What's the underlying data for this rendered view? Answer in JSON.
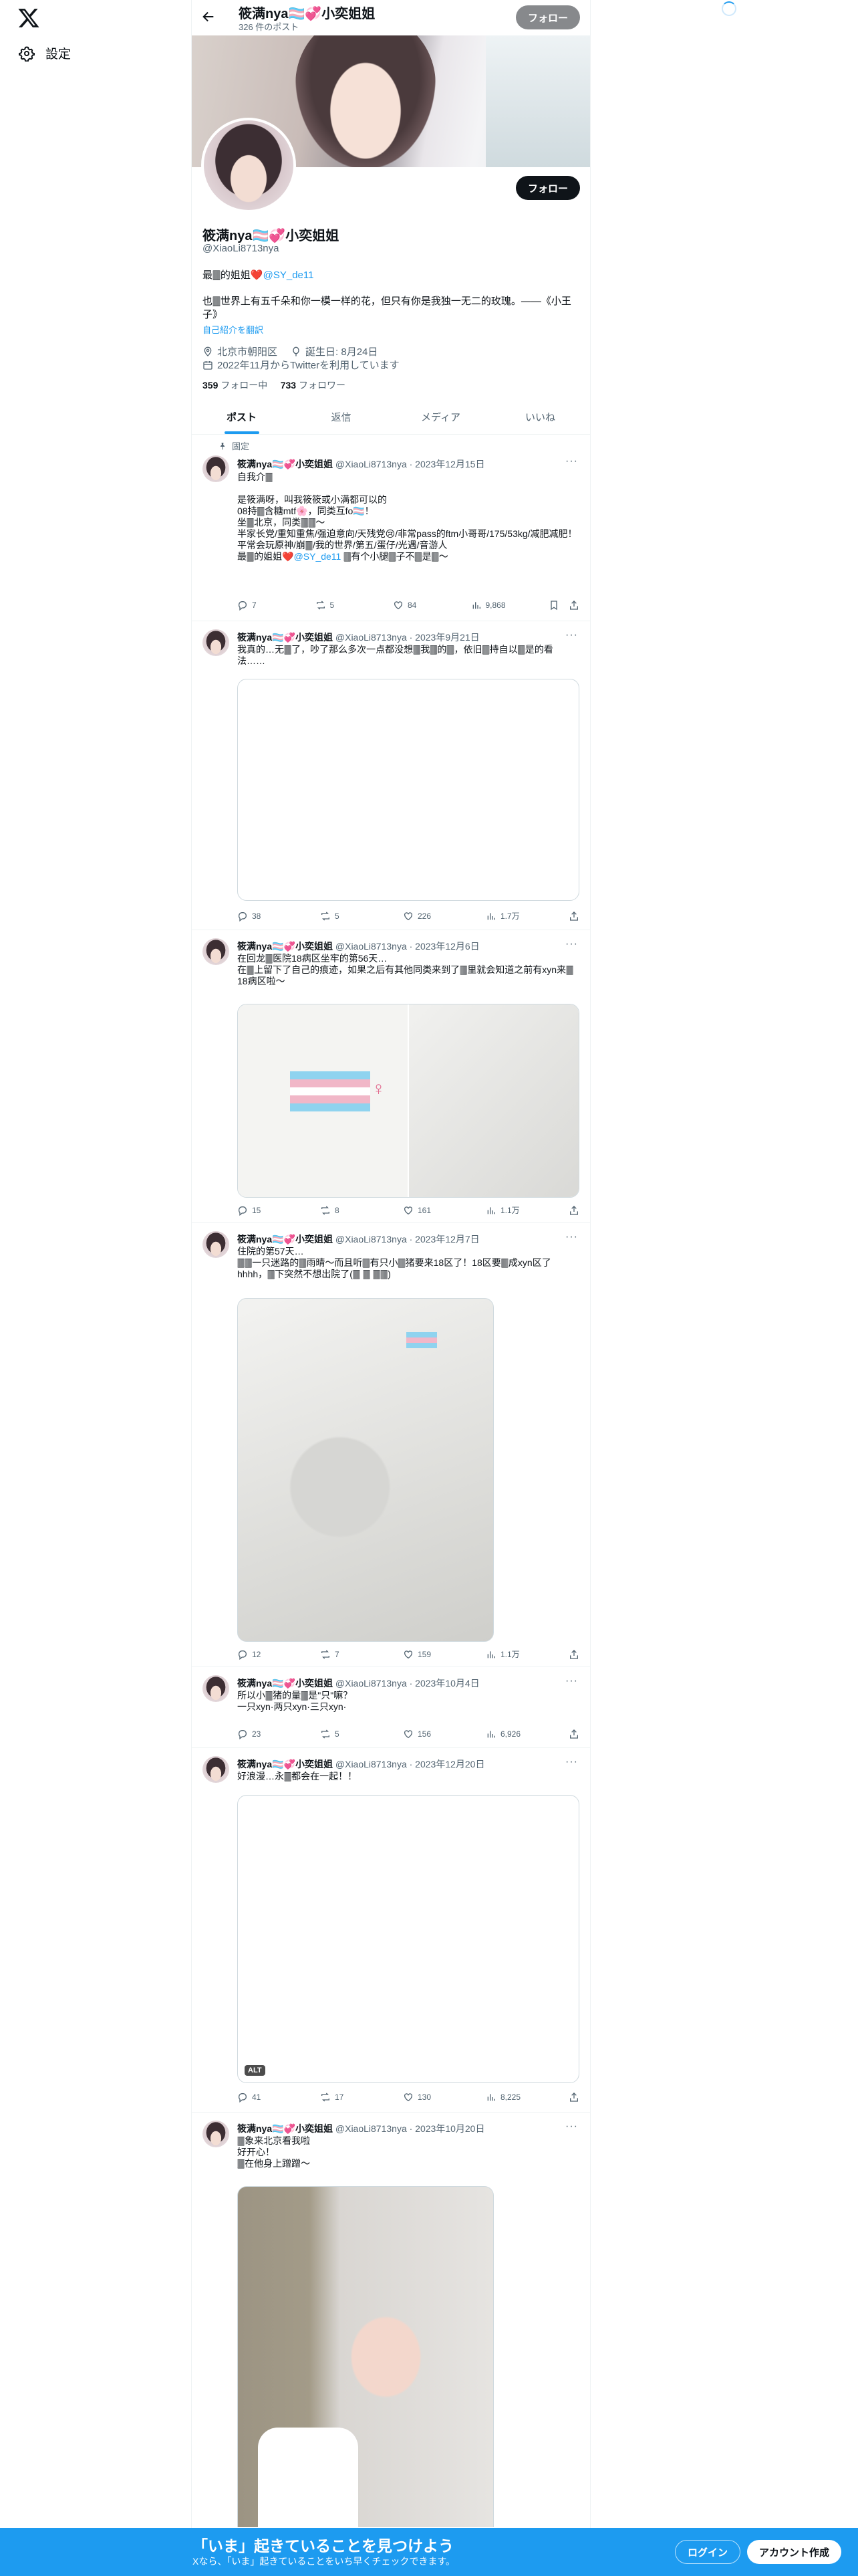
{
  "left_nav": {
    "settings_label": "設定"
  },
  "header": {
    "name": "筱满nya🏳️‍⚧️💞小奕姐姐",
    "post_count": "326 件のポスト",
    "follow_label": "フォロー"
  },
  "profile": {
    "name": "筱满nya🏳️‍⚧️💞小奕姐姐",
    "handle": "@XiaoLi8713nya",
    "bio_line1": "最🀫的姐姐❤️",
    "bio_link": "@SY_de11",
    "bio_line2": "也🀫世界上有五千朵和你一模一样的花，但只有你是我独一无二的玫瑰。——《小王子》",
    "translate_label": "自己紹介を翻訳",
    "location": "北京市朝阳区",
    "birthday": "誕生日: 8月24日",
    "joined": "2022年11月からTwitterを利用しています",
    "following_count": "359",
    "following_label": "フォロー中",
    "followers_count": "733",
    "followers_label": "フォロワー",
    "follow_label": "フォロー"
  },
  "tabs": [
    "ポスト",
    "返信",
    "メディア",
    "いいね"
  ],
  "pinned_label": "固定",
  "posts": [
    {
      "name": "筱满nya🏳️‍⚧️💞小奕姐姐",
      "meta": "@XiaoLi8713nya · 2023年12月15日",
      "text": "自我介🀫\n\n是筱满呀，叫我筱筱或小满都可以的\n08持🀫含糖mtf🌸，同类互fo🏳️‍⚧️！\n坐🀫北京，同类🀫🀫～\n半家长党/重知重焦/强迫意向/天残党😢/非常pass的ftm小哥哥/175/53kg/减肥减肥！\n平常会玩原神/崩🀫/我的世界/第五/蛋仔/光遇/音游人\n最🀫的姐姐❤️",
      "text_link": "@SY_de11",
      "text_tail": " 🀫有个小腿🀫子不🀫是🀫～",
      "replies": "7",
      "reposts": "5",
      "likes": "84",
      "views": "9,868"
    },
    {
      "name": "筱满nya🏳️‍⚧️💞小奕姐姐",
      "meta": "@XiaoLi8713nya · 2023年9月21日",
      "text": "我真的…无🀫了，吵了那么多次一点都没想🀫我🀫的🀫，依旧🀫持自以🀫是的看法……",
      "replies": "38",
      "reposts": "5",
      "likes": "226",
      "views": "1.7万"
    },
    {
      "name": "筱满nya🏳️‍⚧️💞小奕姐姐",
      "meta": "@XiaoLi8713nya · 2023年12月6日",
      "text": "在回龙🀫医院18病区坐牢的第56天…\n在🀫上留下了自己的痕迹，如果之后有其他同类来到了🀫里就会知道之前有xyn来🀫18病区啦～",
      "replies": "15",
      "reposts": "8",
      "likes": "161",
      "views": "1.1万"
    },
    {
      "name": "筱满nya🏳️‍⚧️💞小奕姐姐",
      "meta": "@XiaoLi8713nya · 2023年12月7日",
      "text": "住院的第57天…\n🀫🀫一只迷路的🀫雨晴～而且听🀫有只小🀫猪要来18区了！18区要🀫成xyn区了hhhh，🀫下突然不想出院了(🀫 🀫 🀫🀫)",
      "replies": "12",
      "reposts": "7",
      "likes": "159",
      "views": "1.1万"
    },
    {
      "name": "筱满nya🏳️‍⚧️💞小奕姐姐",
      "meta": "@XiaoLi8713nya · 2023年10月4日",
      "text": "所以小🀫猪的量🀫是\"只\"嘛？\n一只xyn·两只xyn·三只xyn·",
      "replies": "23",
      "reposts": "5",
      "likes": "156",
      "views": "6,926"
    },
    {
      "name": "筱满nya🏳️‍⚧️💞小奕姐姐",
      "meta": "@XiaoLi8713nya · 2023年12月20日",
      "text": "好浪漫…永🀫都会在一起！！",
      "alt_label": "ALT",
      "replies": "41",
      "reposts": "17",
      "likes": "130",
      "views": "8,225"
    },
    {
      "name": "筱满nya🏳️‍⚧️💞小奕姐姐",
      "meta": "@XiaoLi8713nya · 2023年10月20日",
      "text": "🀫象来北京看我啦\n好开心！\n🀫在他身上蹭蹭～"
    }
  ],
  "bottom_banner": {
    "title": "「いま」起きていることを見つけよう",
    "subtitle": "Xなら、「いま」起きていることをいち早くチェックできます。",
    "login_label": "ログイン",
    "signup_label": "アカウント作成"
  },
  "colors": {
    "accent": "#1d9bf0",
    "text": "#0f1419",
    "muted": "#536471",
    "border": "#eff3f4"
  }
}
